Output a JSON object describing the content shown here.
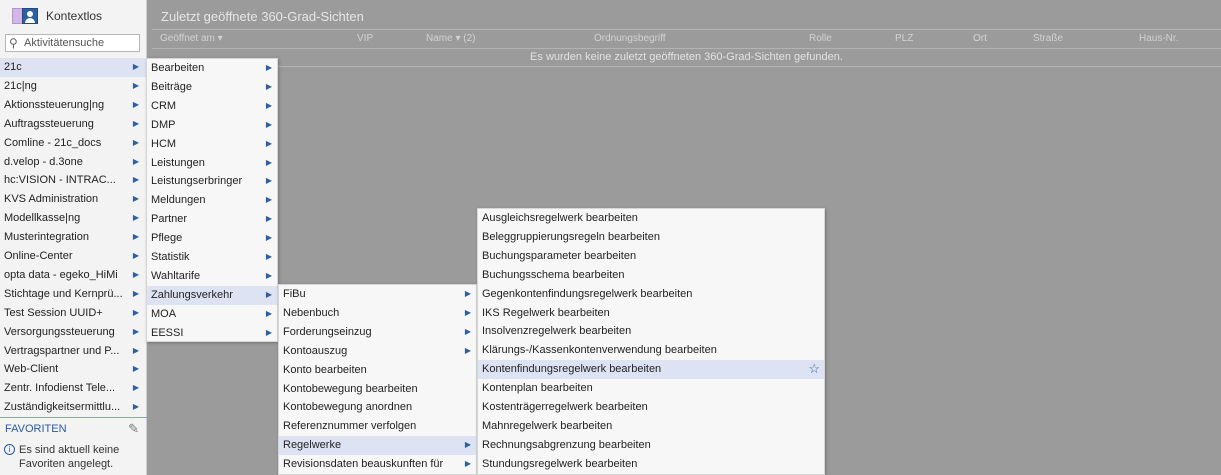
{
  "context": {
    "label": "Kontextlos"
  },
  "search": {
    "placeholder": "Aktivitätensuche"
  },
  "sidebar": {
    "items": [
      {
        "label": "21c"
      },
      {
        "label": "21c|ng"
      },
      {
        "label": "Aktionssteuerung|ng"
      },
      {
        "label": "Auftragssteuerung"
      },
      {
        "label": "Comline - 21c_docs"
      },
      {
        "label": "d.velop - d.3one"
      },
      {
        "label": "hc:VISION - INTRAC..."
      },
      {
        "label": "KVS Administration"
      },
      {
        "label": "Modellkasse|ng"
      },
      {
        "label": "Musterintegration"
      },
      {
        "label": "Online-Center"
      },
      {
        "label": "opta data - egeko_HiMi"
      },
      {
        "label": "Stichtage und Kernprü..."
      },
      {
        "label": "Test Session UUID+"
      },
      {
        "label": "Versorgungssteuerung"
      },
      {
        "label": "Vertragspartner und P..."
      },
      {
        "label": "Web-Client"
      },
      {
        "label": "Zentr. Infodienst Tele..."
      },
      {
        "label": "Zuständigkeitsermittlu..."
      }
    ],
    "favorites_label": "FAVORITEN",
    "favorites_empty": "Es sind aktuell keine Favoriten angelegt."
  },
  "panel": {
    "title": "Zuletzt geöffnete 360-Grad-Sichten",
    "columns": [
      "Geöffnet am ▾",
      "VIP",
      "Name ▾  (2)",
      "Ordnungsbegriff",
      "Rolle",
      "PLZ",
      "Ort",
      "Straße",
      "Haus-Nr."
    ],
    "empty_message": "Es wurden keine zuletzt geöffneten 360-Grad-Sichten gefunden."
  },
  "menu1": {
    "items": [
      {
        "label": "Bearbeiten"
      },
      {
        "label": "Beiträge"
      },
      {
        "label": "CRM"
      },
      {
        "label": "DMP"
      },
      {
        "label": "HCM"
      },
      {
        "label": "Leistungen"
      },
      {
        "label": "Leistungserbringer"
      },
      {
        "label": "Meldungen"
      },
      {
        "label": "Partner"
      },
      {
        "label": "Pflege"
      },
      {
        "label": "Statistik"
      },
      {
        "label": "Wahltarife"
      },
      {
        "label": "Zahlungsverkehr"
      },
      {
        "label": "MOA"
      },
      {
        "label": "EESSI"
      }
    ]
  },
  "menu2": {
    "items": [
      {
        "label": "FiBu"
      },
      {
        "label": "Nebenbuch"
      },
      {
        "label": "Forderungseinzug"
      },
      {
        "label": "Kontoauszug"
      },
      {
        "label": "Konto bearbeiten"
      },
      {
        "label": "Kontobewegung bearbeiten"
      },
      {
        "label": "Kontobewegung anordnen"
      },
      {
        "label": "Referenznummer verfolgen"
      },
      {
        "label": "Regelwerke"
      },
      {
        "label": "Revisionsdaten beauskunften für"
      }
    ]
  },
  "menu3": {
    "items": [
      {
        "label": "Ausgleichsregelwerk bearbeiten"
      },
      {
        "label": "Beleggruppierungsregeln bearbeiten"
      },
      {
        "label": "Buchungsparameter bearbeiten"
      },
      {
        "label": "Buchungsschema bearbeiten"
      },
      {
        "label": "Gegenkontenfindungsregelwerk bearbeiten"
      },
      {
        "label": "IKS Regelwerk bearbeiten"
      },
      {
        "label": "Insolvenzregelwerk bearbeiten"
      },
      {
        "label": "Klärungs-/Kassenkontenverwendung bearbeiten"
      },
      {
        "label": "Kontenfindungsregelwerk bearbeiten"
      },
      {
        "label": "Kontenplan bearbeiten"
      },
      {
        "label": "Kostenträgerregelwerk bearbeiten"
      },
      {
        "label": "Mahnregelwerk bearbeiten"
      },
      {
        "label": "Rechnungsabgrenzung bearbeiten"
      },
      {
        "label": "Stundungsregelwerk bearbeiten"
      }
    ]
  },
  "colors": {
    "accent": "#2f5fa0",
    "highlight": "#dde3f3",
    "backdrop": "#9b9b9b"
  }
}
